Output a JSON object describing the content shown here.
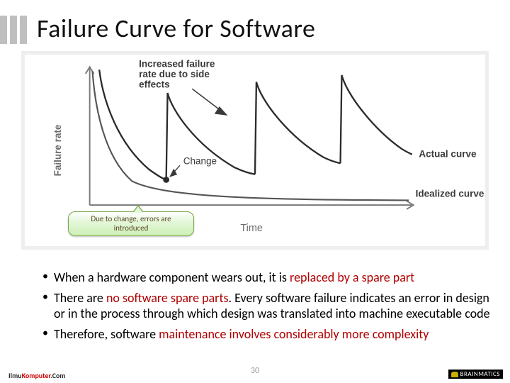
{
  "title": "Failure Curve for Software",
  "figure": {
    "y_axis_label": "Failure rate",
    "x_axis_label": "Time",
    "annotation_increased": "Increased failure rate due to side effects",
    "label_change": "Change",
    "label_actual": "Actual curve",
    "label_idealized": "Idealized curve"
  },
  "callout": "Due to change, errors are introduced",
  "bullets": [
    {
      "pre": "When a hardware component wears out, it is ",
      "hl": "replaced by a spare part",
      "post": ""
    },
    {
      "pre": "There are ",
      "hl": "no software spare parts",
      "post": ". Every software failure indicates an error in design or in the process through which design was translated into machine executable code"
    },
    {
      "pre": "Therefore, software ",
      "hl": "maintenance involves considerably more complexity",
      "post": ""
    }
  ],
  "footer": {
    "page": "30",
    "left_ilmu": "Ilmu",
    "left_kom": "Komputer",
    "left_com": ".Com",
    "right_pre": "B",
    "right_post": "RAINMATICS"
  },
  "chart_data": {
    "type": "line",
    "title": "Failure Curve for Software",
    "xlabel": "Time",
    "ylabel": "Failure rate",
    "x_range": [
      0,
      10
    ],
    "y_range": [
      0,
      10
    ],
    "series": [
      {
        "name": "Idealized curve",
        "x": [
          0.0,
          0.2,
          0.5,
          1.0,
          1.5,
          2.0,
          3.0,
          4.0,
          6.0,
          8.0,
          10.0
        ],
        "y": [
          10.0,
          6.5,
          4.3,
          2.7,
          2.0,
          1.6,
          1.2,
          1.05,
          0.95,
          0.9,
          0.88
        ]
      },
      {
        "name": "Actual curve",
        "segments": [
          {
            "x": [
              0.3,
              0.5,
              0.8,
              1.3,
              1.8,
              2.3
            ],
            "y": [
              10.0,
              7.2,
              5.3,
              3.9,
              3.2,
              2.95
            ]
          },
          {
            "x": [
              2.3,
              2.32,
              2.6,
              3.2,
              3.8,
              4.4,
              5.0
            ],
            "y": [
              2.95,
              7.5,
              5.8,
              4.5,
              3.9,
              3.55,
              3.45
            ]
          },
          {
            "x": [
              5.0,
              5.02,
              5.4,
              6.0,
              6.8,
              7.5
            ],
            "y": [
              3.45,
              8.5,
              6.5,
              5.3,
              4.7,
              4.4
            ]
          },
          {
            "x": [
              7.5,
              7.52,
              8.0,
              8.8,
              9.5,
              10.0
            ],
            "y": [
              4.4,
              9.0,
              7.0,
              5.8,
              5.2,
              5.0
            ]
          }
        ]
      }
    ],
    "annotations": [
      {
        "text": "Increased failure rate due to side effects",
        "target": "spike after change",
        "x": 3.0,
        "y": 9.2
      },
      {
        "text": "Change",
        "x": 2.3,
        "y": 2.95,
        "marker": "point"
      },
      {
        "text": "Actual curve",
        "x": 9.4,
        "y": 5.2,
        "side": "right"
      },
      {
        "text": "Idealized curve",
        "x": 9.4,
        "y": 0.9,
        "side": "right"
      }
    ]
  }
}
